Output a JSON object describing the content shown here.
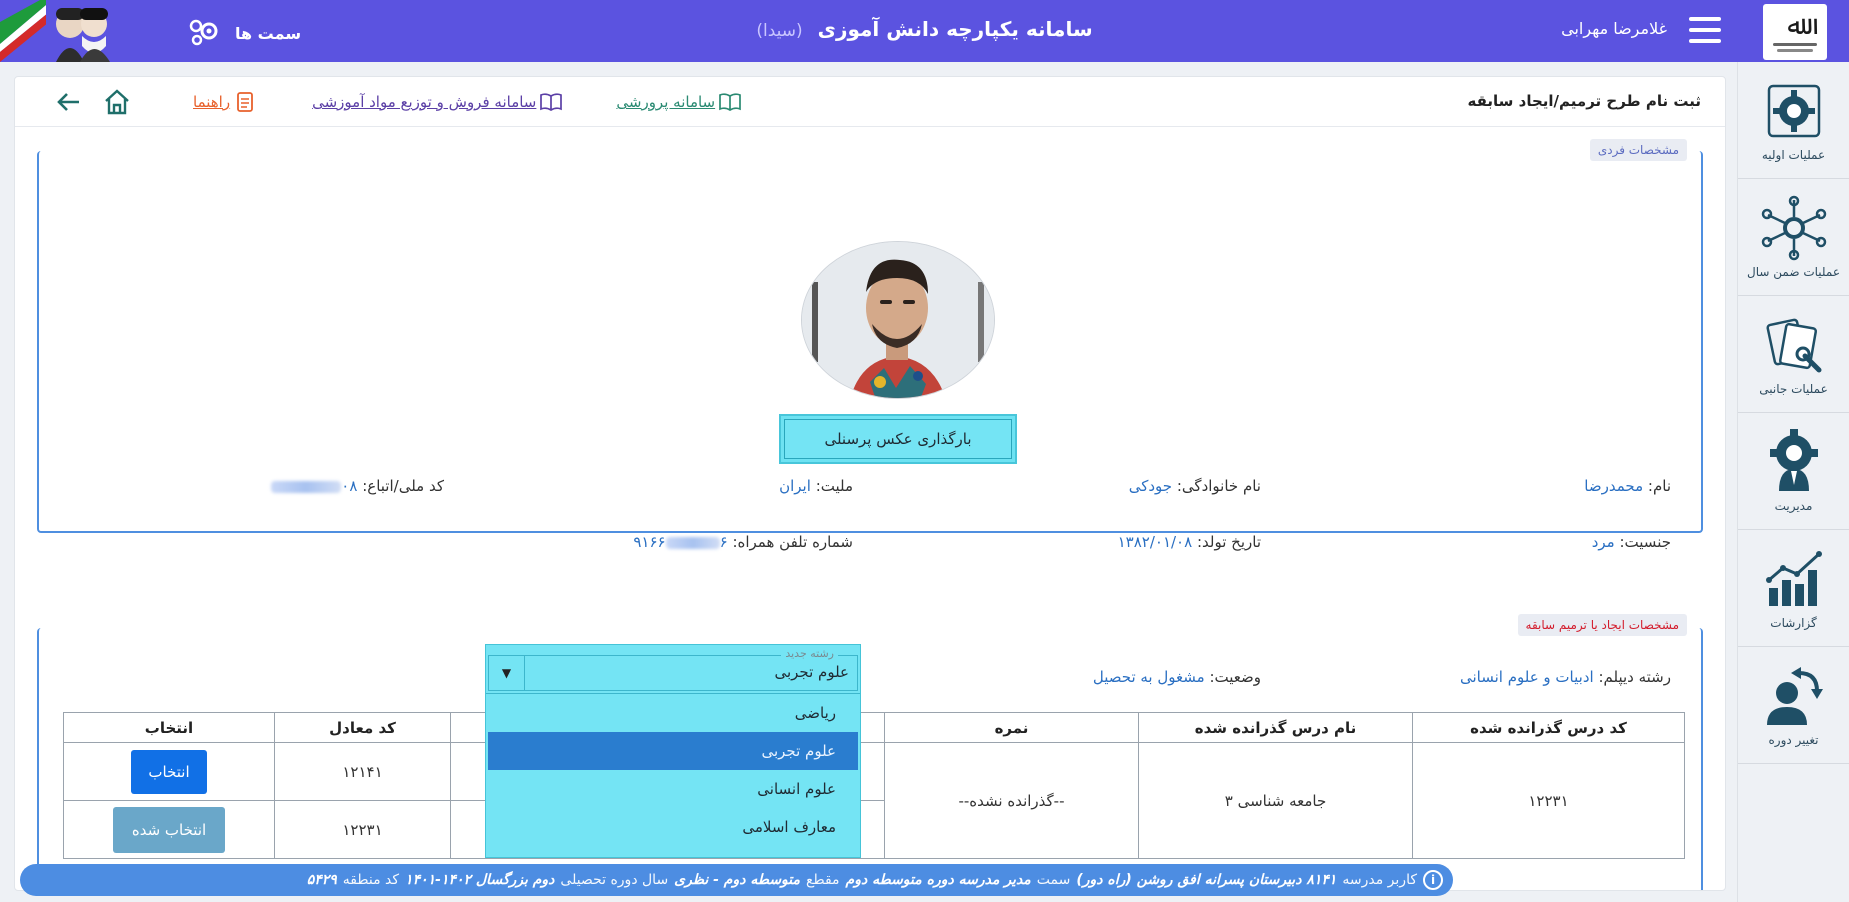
{
  "topbar": {
    "app_title": "سامانه یکپارچه دانش آموزی",
    "app_subtitle": "(سیدا)",
    "username": "غلامرضا مهرابی",
    "roles_label": "سمت ها",
    "colors": {
      "bar": "#5b53e0"
    }
  },
  "sidebar": {
    "items": [
      {
        "label": "عملیات اولیه",
        "icon": "gear-cycle-icon"
      },
      {
        "label": "عملیات ضمن سال",
        "icon": "network-hub-icon"
      },
      {
        "label": "عملیات جانبی",
        "icon": "cards-wrench-icon"
      },
      {
        "label": "مدیریت",
        "icon": "manager-gear-icon"
      },
      {
        "label": "گزارشات",
        "icon": "bar-chart-icon"
      },
      {
        "label": "تغییر دوره",
        "icon": "user-switch-icon"
      }
    ]
  },
  "page": {
    "title": "ثبت نام طرح ترمیم/ایجاد سابقه",
    "links": {
      "edu": "سامانه پرورشی",
      "sales": "سامانه فروش و توزیع مواد آموزشی",
      "guide": "راهنما"
    }
  },
  "personal": {
    "legend": "مشخصات فردی",
    "upload_label": "بارگذاری عکس پرسنلی",
    "first_name_label": "نام:",
    "first_name": "محمدرضا",
    "last_name_label": "نام خانوادگی:",
    "last_name": "جودکی",
    "nationality_label": "ملیت:",
    "nationality": "ایران",
    "national_id_label": "کد ملی/اتباع:",
    "national_id_visible": "۰۸",
    "gender_label": "جنسیت:",
    "gender": "مرد",
    "birth_label": "تاریخ تولد:",
    "birth": "۱۳۸۲/۰۱/۰۸",
    "phone_label": "شماره تلفن همراه:",
    "phone_visible_start": "۹۱۶۶",
    "phone_visible_end": "۶"
  },
  "record": {
    "legend": "مشخصات ایجاد یا ترمیم سابقه",
    "diploma_label": "رشته دیپلم:",
    "diploma": "ادبیات و علوم انسانی",
    "status_label": "وضعیت:",
    "status": "مشغول به تحصیل",
    "new_field_label": "رشته جدید",
    "new_field_value": "علوم تجربی",
    "options": [
      "ریاضی",
      "علوم تجربی",
      "علوم انسانی",
      "معارف اسلامی"
    ],
    "selected_index": 1
  },
  "table": {
    "headers": [
      "کد درس گذرانده شده",
      "نام درس گذرانده شده",
      "نمره",
      "",
      "کد معادل",
      "انتخاب"
    ],
    "rows": [
      {
        "code": "۱۲۲۳۱",
        "name": "جامعه شناسی ۳",
        "grade": "--گذرانده نشده--",
        "equiv": "۱۲۱۴۱",
        "action": "انتخاب"
      },
      {
        "code": "",
        "name": "",
        "grade": "",
        "equiv": "۱۲۲۳۱",
        "action": "انتخاب شده"
      }
    ]
  },
  "status_bar": {
    "user_label": "کاربر مدرسه",
    "school": "۸۱۴۱ دبیرستان پسرانه افق روشن (راه دور)",
    "role_label": "سمت",
    "role": "مدیر مدرسه دوره متوسطه دوم",
    "level_label": "مقطع",
    "level": "متوسطه دوم - نظری",
    "year_label": "سال دوره تحصیلی",
    "year": "دوم بزرگسال ۱۴۰۲-۱۴۰۱",
    "region_label": "کد منطقه",
    "region": "۵۴۲۹"
  }
}
